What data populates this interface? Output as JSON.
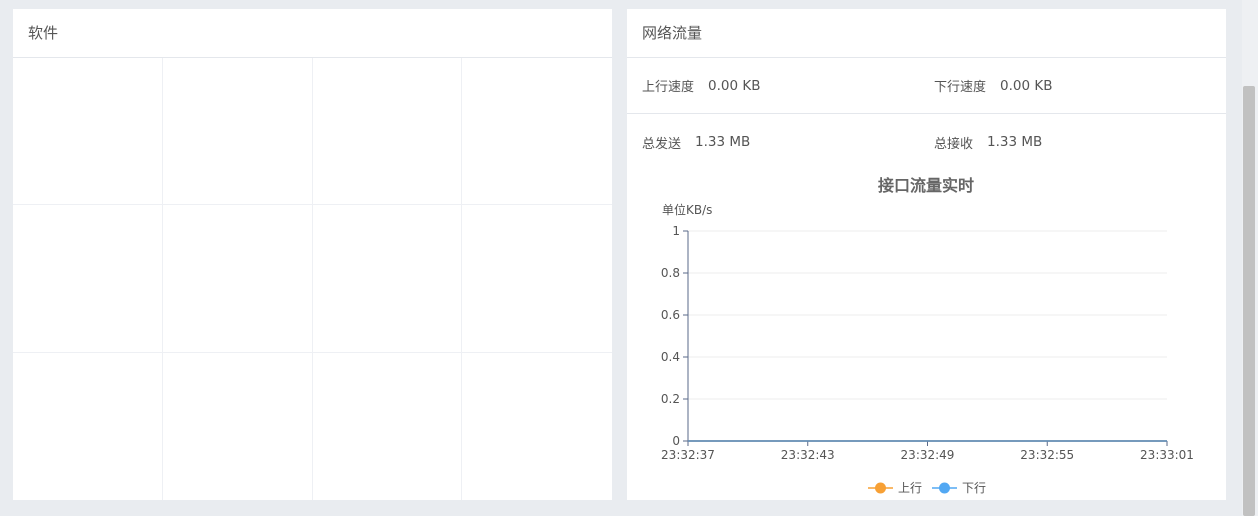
{
  "software": {
    "title": "软件"
  },
  "network": {
    "title": "网络流量",
    "upload_speed_label": "上行速度",
    "upload_speed_value": "0.00 KB",
    "download_speed_label": "下行速度",
    "download_speed_value": "0.00 KB",
    "total_sent_label": "总发送",
    "total_sent_value": "1.33 MB",
    "total_received_label": "总接收",
    "total_received_value": "1.33 MB"
  },
  "chart_data": {
    "type": "line",
    "title": "接口流量实时",
    "ylabel": "单位KB/s",
    "xlabel": "",
    "ylim": [
      0,
      1
    ],
    "yticks": [
      "0",
      "0.2",
      "0.4",
      "0.6",
      "0.8",
      "1"
    ],
    "x_ticks": [
      "23:32:37",
      "23:32:43",
      "23:32:49",
      "23:32:55",
      "23:33:01"
    ],
    "x": [
      "23:32:37",
      "23:32:43",
      "23:32:49",
      "23:32:55",
      "23:33:01"
    ],
    "series": [
      {
        "name": "上行",
        "color": "#f7a035",
        "values": [
          0,
          0,
          0,
          0,
          0
        ]
      },
      {
        "name": "下行",
        "color": "#52a8f3",
        "values": [
          0,
          0,
          0,
          0,
          0
        ]
      }
    ],
    "legend_position": "bottom-center",
    "grid": true
  },
  "colors": {
    "upload": "#f7a035",
    "download": "#52a8f3",
    "axis": "#5a6a8a"
  }
}
